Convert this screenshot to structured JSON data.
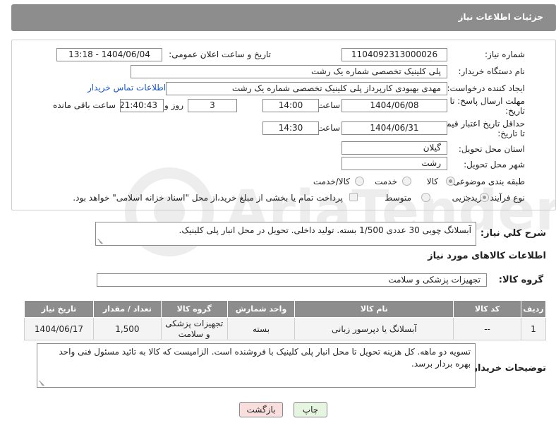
{
  "header": {
    "title": "جزئیات اطلاعات نیاز"
  },
  "form": {
    "need_number_label": "شماره نیاز:",
    "need_number": "1104092313000026",
    "announce_label": "تاریخ و ساعت اعلان عمومی:",
    "announce_value": "1404/06/04 - 13:18",
    "buyer_org_label": "نام دستگاه خریدار:",
    "buyer_org": "پلی کلینیک تخصصی شماره یک رشت",
    "creator_label": "ایجاد کننده درخواست:",
    "creator": "مهدی بهبودی کارپرداز پلی کلینیک تخصصی شماره یک رشت",
    "contact_link": "اطلاعات تماس خریدار",
    "deadline_label": "مهلت ارسال پاسخ: تا تاریخ:",
    "deadline_date": "1404/06/08",
    "time_label": "ساعت",
    "deadline_time": "14:00",
    "days_value": "3",
    "days_label": "روز و",
    "remaining_time": "21:40:43",
    "remaining_label": "ساعت باقی مانده",
    "validity_label": "حداقل تاریخ اعتبار قیمت: تا تاریخ:",
    "validity_date": "1404/06/31",
    "validity_time": "14:30",
    "province_label": "استان محل تحویل:",
    "province": "گیلان",
    "city_label": "شهر محل تحویل:",
    "city": "رشت",
    "category_label": "طبقه بندی موضوعی:",
    "category_options": [
      "کالا",
      "خدمت",
      "کالا/خدمت"
    ],
    "process_label": "نوع فرآیند خرید :",
    "process_options": [
      "جزیی",
      "متوسط"
    ],
    "payment_text": "پرداخت تمام یا بخشی از مبلغ خرید،از محل \"اسناد خزانه اسلامی\" خواهد بود."
  },
  "summary": {
    "label": "شرح کلي نياز:",
    "text": "آبسلانگ چوبی 30 عددی 1/500 بسته. تولید داخلی. تحویل در محل انبار پلی کلینیک."
  },
  "goods": {
    "section_title": "اطلاعات کالاهای مورد نیاز",
    "group_label": "گروه کالا:",
    "group_value": "تجهیزات پزشکی و سلامت",
    "columns": [
      "ردیف",
      "کد کالا",
      "نام کالا",
      "واحد شمارش",
      "گروه کالا",
      "تعداد / مقدار",
      "تاریخ نیاز"
    ],
    "rows": [
      [
        "1",
        "--",
        "آبسلانگ یا دپرسور زبانی",
        "بسته",
        "تجهیزات پزشکی و سلامت",
        "1,500",
        "1404/06/17"
      ]
    ]
  },
  "buyer_notes": {
    "label": "توضیحات خریدار:",
    "text": "تسویه دو ماهه. کل هزینه تحویل تا محل انبار پلی کلینیک با فروشنده است. الزامیست که کالا به تائید مسئول فنی واحد بهره بردار برسد."
  },
  "buttons": {
    "print": "چاپ",
    "back": "بازگشت"
  },
  "colors": {
    "header_bg": "#8d8d8d",
    "link": "#1a56c9",
    "back_btn_bg": "#f9dede",
    "print_btn_bg": "#e6f5e0"
  }
}
